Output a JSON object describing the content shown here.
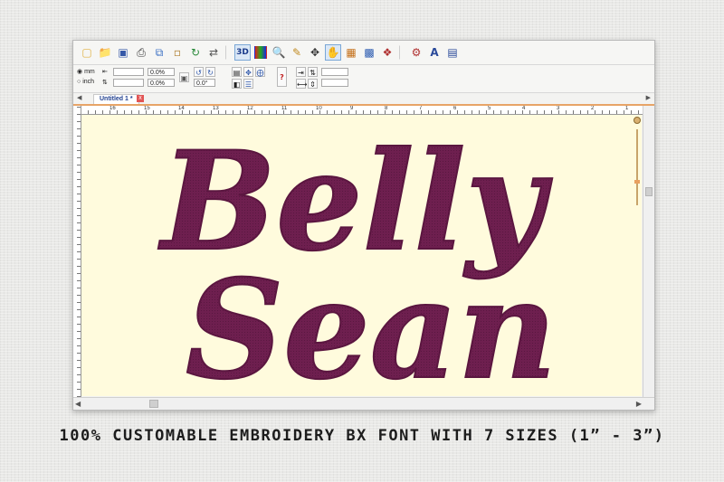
{
  "toolbar": {
    "icons": [
      "new-file-icon",
      "open-folder-icon",
      "save-icon",
      "print-icon",
      "copy-icon",
      "paste-icon",
      "rotate-icon",
      "flip-icon",
      "3d-view-icon",
      "color-icon",
      "zoom-icon",
      "measure-icon",
      "move-icon",
      "hand-icon",
      "grid-icon",
      "stitch-icon",
      "design-icon",
      "settings-icon",
      "font-icon",
      "layers-icon"
    ],
    "view3d_label": "3D",
    "font_letter": "A"
  },
  "options": {
    "unit_mm": "mm",
    "unit_inch": "inch",
    "width_pct": "0.0%",
    "height_pct": "0.0%",
    "angle": "0.0°"
  },
  "tab": {
    "title": "Untitled 1 *",
    "close": "x"
  },
  "ruler_labels": [
    "16",
    "15",
    "14",
    "13",
    "12",
    "11",
    "10",
    "9",
    "8",
    "7",
    "6",
    "5",
    "4",
    "3",
    "2",
    "1"
  ],
  "design": {
    "line1": "Belly",
    "line2": "Sean",
    "thread_color": "#6e1f4f"
  },
  "caption": "100% CUSTOMABLE EMBROIDERY BX FONT WITH 7 SIZES (1”  -  3”)"
}
